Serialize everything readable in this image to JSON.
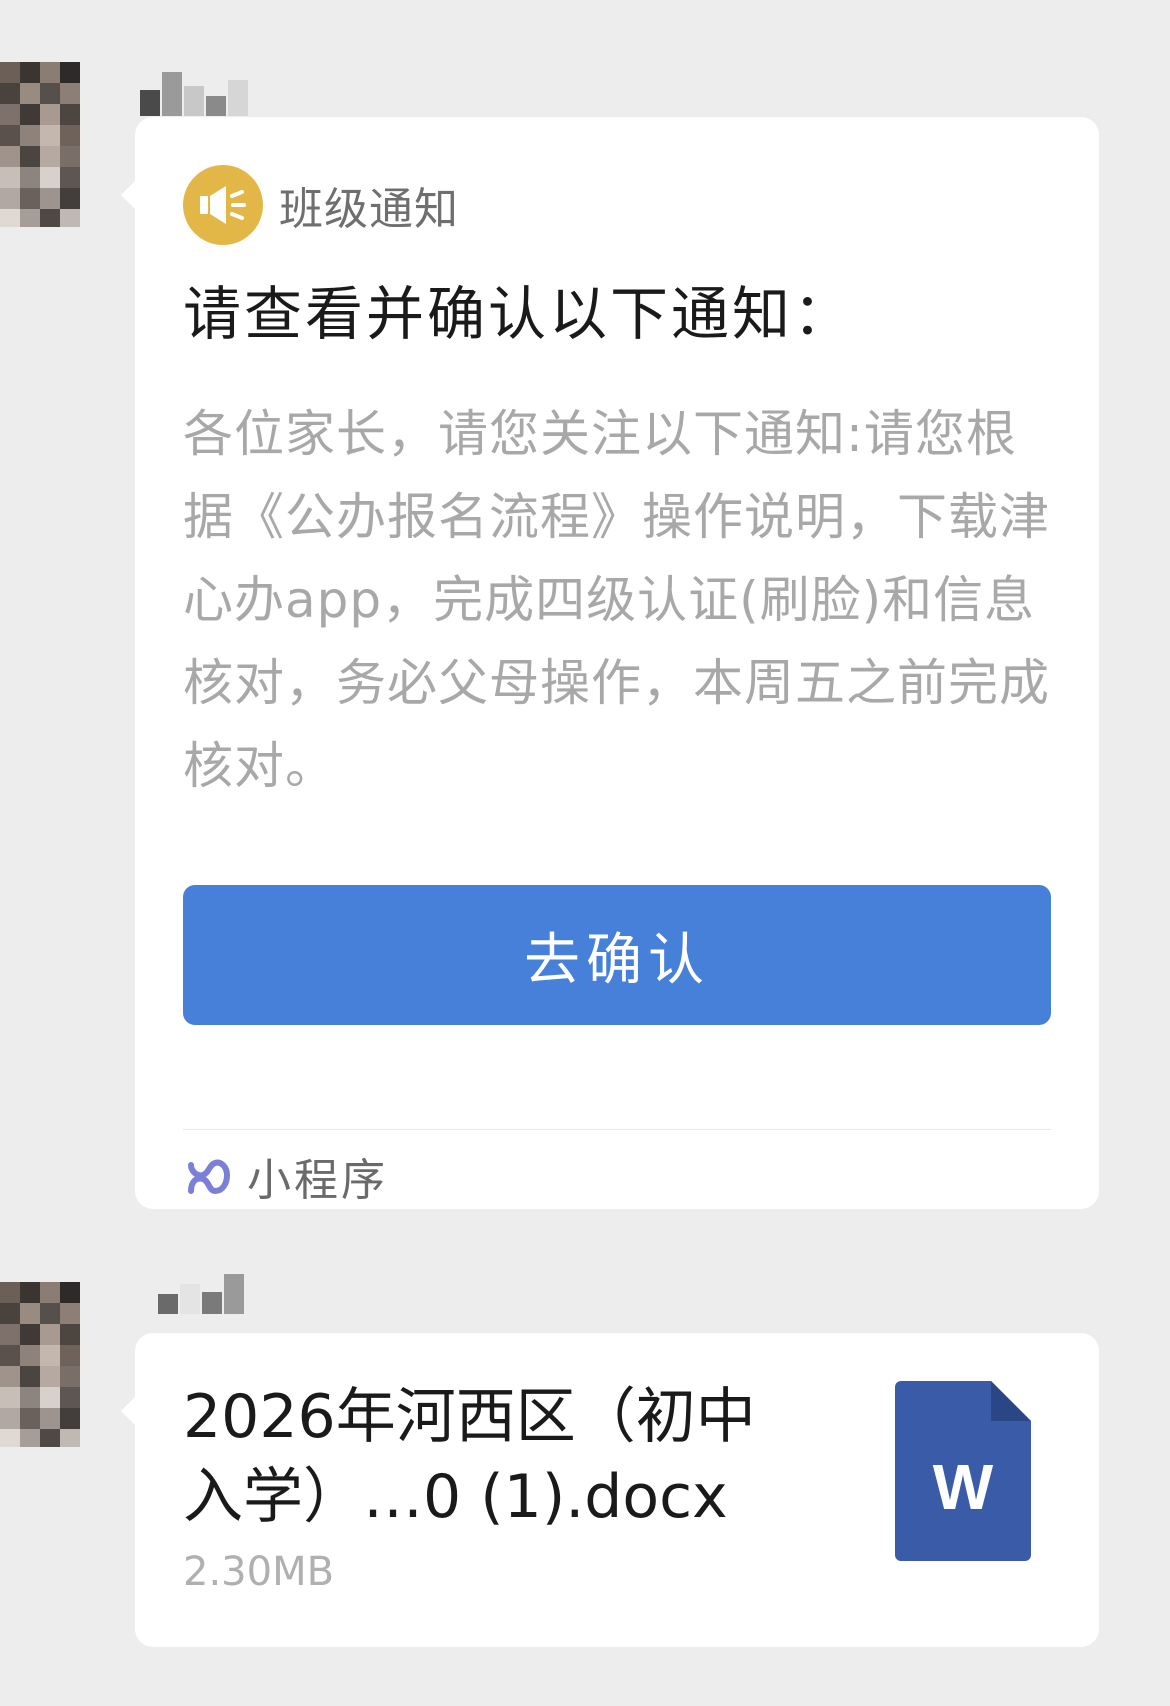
{
  "notice_card": {
    "source_label": "班级通知",
    "title": "请查看并确认以下通知：",
    "body": "各位家长，请您关注以下通知:请您根据《公办报名流程》操作说明，下载津心办app，完成四级认证(刷脸)和信息核对，务必父母操作，本周五之前完成核对。",
    "confirm_label": "去确认",
    "mini_program_label": "小程序"
  },
  "file_card": {
    "file_name": "2026年河西区（初中入学）…0 (1).docx",
    "file_size": "2.30MB",
    "icon_letter": "W"
  },
  "colors": {
    "background": "#ededed",
    "bubble": "#ffffff",
    "notice_icon_bg": "#e3b648",
    "confirm_button": "#4680d9",
    "mini_program_icon": "#7b7fd8",
    "word_icon": "#3a5ca8"
  },
  "icons": {
    "notice": "megaphone-icon",
    "mini_program": "mini-program-link-icon",
    "document": "word-document-icon"
  }
}
